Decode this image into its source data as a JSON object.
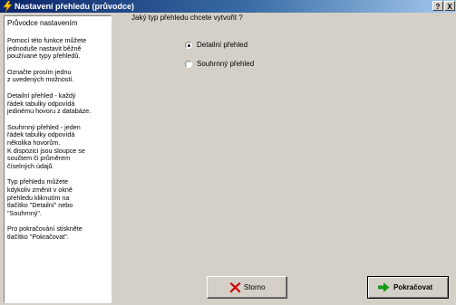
{
  "window": {
    "title": "Nastavení přehledu (průvodce)",
    "help_label": "?",
    "close_label": "X",
    "title_icon": "lightning-bolt-icon"
  },
  "sidebar": {
    "title": "Průvodce nastavením",
    "paragraphs": [
      "Pomocí této funkce můžete\njednoduše nastavit běžně\npoužívané typy přehledů.",
      "Označte prosím jednu\nz uvedených možností.",
      "Detailní přehled - každý\nřádek tabulky odpovídá\njedinému hovoru z databáze.",
      "Souhrnný přehled - jeden\nřádek tabulky odpovídá\nněkolika hovorům.\nK dispozici jsou sloupce se\nsoučtem či průměrem\nčíselných údajů.",
      "Typ přehledu můžete\nkdykoliv změnit v okně\npřehledu kliknutím na\ntlačítko \"Detailní\" nebo\n\"Souhrnný\".",
      "Pro pokračování stiskněte\ntlačítko \"Pokračovat\"."
    ]
  },
  "main": {
    "question": "Jaký typ přehledu chcete vytvořit ?",
    "options": [
      {
        "label": "Detailní přehled",
        "checked": true
      },
      {
        "label": "Souhrnný přehled",
        "checked": false
      }
    ]
  },
  "buttons": {
    "cancel_label": "Storno",
    "cancel_icon": "red-x-icon",
    "next_label": "Pokračovat",
    "next_icon": "green-arrow-right-icon"
  },
  "colors": {
    "titlebar_start": "#0a246a",
    "titlebar_end": "#a6caf0",
    "face": "#d4d0c8",
    "cancel_icon": "#cc0000",
    "next_icon": "#1a9a1a"
  }
}
